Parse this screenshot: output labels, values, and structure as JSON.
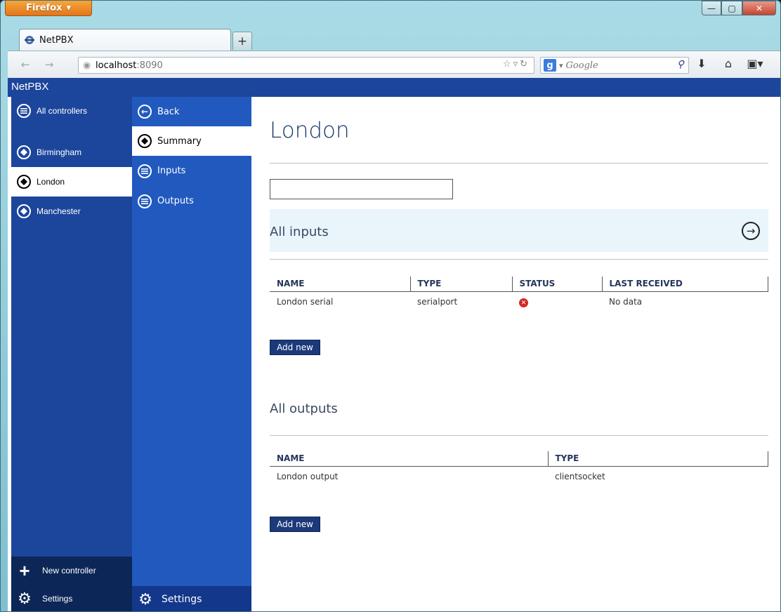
{
  "browser": {
    "menu_button": "Firefox",
    "tab_title": "NetPBX",
    "new_tab": "+",
    "url_host": "localhost",
    "url_port": ":8090",
    "search_placeholder": "Google",
    "window_controls": [
      "minimize-icon",
      "maximize-icon",
      "close-icon"
    ]
  },
  "app": {
    "title": "NetPBX"
  },
  "controllers_nav": {
    "all_label": "All controllers",
    "items": [
      {
        "label": "Birmingham",
        "active": false
      },
      {
        "label": "London",
        "active": true
      },
      {
        "label": "Manchester",
        "active": false
      }
    ],
    "new_controller_label": "New controller",
    "settings_label": "Settings"
  },
  "detail_nav": {
    "back_label": "Back",
    "items": [
      {
        "label": "Summary",
        "active": true
      },
      {
        "label": "Inputs",
        "active": false
      },
      {
        "label": "Outputs",
        "active": false
      }
    ],
    "settings_label": "Settings"
  },
  "main": {
    "page_title": "London",
    "filter_value": "",
    "inputs": {
      "title": "All inputs",
      "columns": [
        "NAME",
        "TYPE",
        "STATUS",
        "LAST RECEIVED"
      ],
      "rows": [
        {
          "name": "London serial",
          "type": "serialport",
          "status": "error",
          "last_received": "No data"
        }
      ],
      "add_label": "Add new"
    },
    "outputs": {
      "title": "All outputs",
      "columns": [
        "NAME",
        "TYPE"
      ],
      "rows": [
        {
          "name": "London output",
          "type": "clientsocket"
        }
      ],
      "add_label": "Add new"
    }
  },
  "colors": {
    "app_bar": "#1c469c",
    "detail_nav": "#2159be",
    "footer_dark": "#0c2757",
    "section_band": "#e9f5fb",
    "status_error": "#d22a22"
  }
}
